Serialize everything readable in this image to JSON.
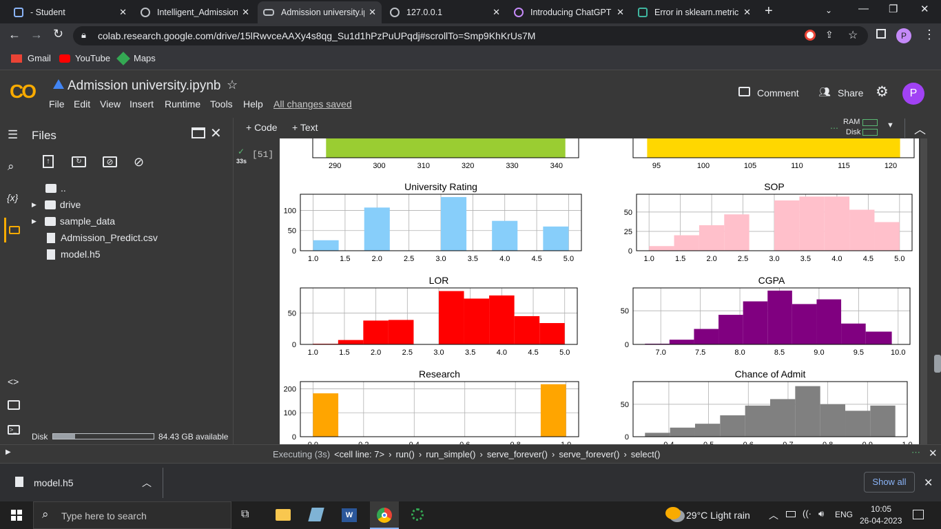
{
  "tabs": [
    {
      "label": "- Student"
    },
    {
      "label": "Intelligent_Admissions"
    },
    {
      "label": "Admission university.ip"
    },
    {
      "label": "127.0.0.1"
    },
    {
      "label": "Introducing ChatGPT"
    },
    {
      "label": "Error in sklearn.metric"
    }
  ],
  "address": {
    "url": "colab.research.google.com/drive/15lRwvceAAXy4s8qg_Su1d1hPzPuUPqdj#scrollTo=Smp9KhKrUs7M"
  },
  "bookmarks": [
    {
      "label": "Gmail"
    },
    {
      "label": "YouTube"
    },
    {
      "label": "Maps"
    }
  ],
  "colab": {
    "logo": "CO",
    "title": "Admission university.ipynb",
    "menu": [
      "File",
      "Edit",
      "View",
      "Insert",
      "Runtime",
      "Tools",
      "Help"
    ],
    "saved": "All changes saved",
    "comment": "Comment",
    "share": "Share",
    "avatar": "P",
    "add_code": "+ Code",
    "add_text": "+ Text",
    "ram": "RAM",
    "disk": "Disk",
    "cell_exec": "[51]",
    "cell_time": "33s"
  },
  "files": {
    "title": "Files",
    "items": [
      "..",
      "drive",
      "sample_data",
      "Admission_Predict.csv",
      "model.h5"
    ],
    "disk_label": "Disk",
    "disk_avail": "84.43 GB available",
    "disk_used_fraction": 0.22
  },
  "status": {
    "executing": "Executing (3s)",
    "trace": [
      "<cell line: 7>",
      "run()",
      "run_simple()",
      "serve_forever()",
      "serve_forever()",
      "select()"
    ]
  },
  "download": {
    "file": "model.h5",
    "show_all": "Show all"
  },
  "taskbar": {
    "search": "Type here to search",
    "weather": "29°C  Light rain",
    "lang": "ENG",
    "time": "10:05",
    "date": "26-04-2023"
  },
  "chart_data": [
    {
      "type": "bar",
      "title": "",
      "partial": true,
      "x_ticks": [
        "290",
        "300",
        "310",
        "320",
        "330",
        "340"
      ],
      "color": "#9acd32"
    },
    {
      "type": "bar",
      "title": "",
      "partial": true,
      "x_ticks": [
        "95",
        "100",
        "105",
        "110",
        "115",
        "120"
      ],
      "color": "#ffd700"
    },
    {
      "type": "bar",
      "title": "University Rating",
      "color": "#87cefa",
      "xlim": [
        0.8,
        5.2
      ],
      "ylim": [
        0,
        140
      ],
      "x_ticks": [
        "1.0",
        "1.5",
        "2.0",
        "2.5",
        "3.0",
        "3.5",
        "4.0",
        "4.5",
        "5.0"
      ],
      "y_ticks": [
        "0",
        "50",
        "100"
      ],
      "bins": [
        [
          1.0,
          1.4,
          26
        ],
        [
          1.8,
          2.2,
          107
        ],
        [
          2.6,
          3.0,
          0
        ],
        [
          3.0,
          3.4,
          133
        ],
        [
          3.8,
          4.2,
          74
        ],
        [
          4.6,
          5.0,
          60
        ]
      ]
    },
    {
      "type": "bar",
      "title": "SOP",
      "color": "#ffc0cb",
      "xlim": [
        0.8,
        5.2
      ],
      "ylim": [
        0,
        73
      ],
      "x_ticks": [
        "1.0",
        "1.5",
        "2.0",
        "2.5",
        "3.0",
        "3.5",
        "4.0",
        "4.5",
        "5.0"
      ],
      "y_ticks": [
        "0",
        "25",
        "50"
      ],
      "bins": [
        [
          1.0,
          1.4,
          6
        ],
        [
          1.4,
          1.8,
          20
        ],
        [
          1.8,
          2.2,
          33
        ],
        [
          2.2,
          2.6,
          47
        ],
        [
          2.6,
          3.0,
          0
        ],
        [
          3.0,
          3.4,
          65
        ],
        [
          3.4,
          3.8,
          70
        ],
        [
          3.8,
          4.2,
          70
        ],
        [
          4.2,
          4.6,
          53
        ],
        [
          4.6,
          5.0,
          37
        ]
      ]
    },
    {
      "type": "bar",
      "title": "LOR",
      "color": "#ff0000",
      "xlim": [
        0.8,
        5.2
      ],
      "ylim": [
        0,
        90
      ],
      "x_ticks": [
        "1.0",
        "1.5",
        "2.0",
        "2.5",
        "3.0",
        "3.5",
        "4.0",
        "4.5",
        "5.0"
      ],
      "y_ticks": [
        "0",
        "50"
      ],
      "bins": [
        [
          1.0,
          1.4,
          1
        ],
        [
          1.4,
          1.8,
          7
        ],
        [
          1.8,
          2.2,
          38
        ],
        [
          2.2,
          2.6,
          39
        ],
        [
          2.6,
          3.0,
          0
        ],
        [
          3.0,
          3.4,
          85
        ],
        [
          3.4,
          3.8,
          73
        ],
        [
          3.8,
          4.2,
          78
        ],
        [
          4.2,
          4.6,
          45
        ],
        [
          4.6,
          5.0,
          34
        ]
      ]
    },
    {
      "type": "bar",
      "title": "CGPA",
      "color": "#800080",
      "xlim": [
        6.65,
        10.15
      ],
      "ylim": [
        0,
        84
      ],
      "x_ticks": [
        "7.0",
        "7.5",
        "8.0",
        "8.5",
        "9.0",
        "9.5",
        "10.0"
      ],
      "y_ticks": [
        "0",
        "50"
      ],
      "bins": [
        [
          6.8,
          7.11,
          1
        ],
        [
          7.11,
          7.42,
          7
        ],
        [
          7.42,
          7.73,
          23
        ],
        [
          7.73,
          8.04,
          44
        ],
        [
          8.04,
          8.35,
          64
        ],
        [
          8.35,
          8.66,
          80
        ],
        [
          8.66,
          8.97,
          60
        ],
        [
          8.97,
          9.28,
          67
        ],
        [
          9.28,
          9.59,
          31
        ],
        [
          9.59,
          9.92,
          19
        ]
      ]
    },
    {
      "type": "bar",
      "title": "Research",
      "color": "#ffa500",
      "xlim": [
        -0.05,
        1.05
      ],
      "ylim": [
        0,
        230
      ],
      "x_ticks": [
        "0.0",
        "0.2",
        "0.4",
        "0.6",
        "0.8",
        "1.0"
      ],
      "y_ticks": [
        "0",
        "100",
        "200"
      ],
      "bins": [
        [
          0.0,
          0.1,
          181
        ],
        [
          0.9,
          1.0,
          219
        ]
      ]
    },
    {
      "type": "bar",
      "title": "Chance of Admit",
      "color": "#808080",
      "xlim": [
        0.31,
        1.0
      ],
      "ylim": [
        0,
        85
      ],
      "x_ticks": [
        "0.4",
        "0.5",
        "0.6",
        "0.7",
        "0.8",
        "0.9",
        "1.0"
      ],
      "y_ticks": [
        "0",
        "50"
      ],
      "bins": [
        [
          0.34,
          0.403,
          6
        ],
        [
          0.403,
          0.466,
          14
        ],
        [
          0.466,
          0.529,
          20
        ],
        [
          0.529,
          0.592,
          33
        ],
        [
          0.592,
          0.655,
          48
        ],
        [
          0.655,
          0.718,
          58
        ],
        [
          0.718,
          0.781,
          78
        ],
        [
          0.781,
          0.844,
          50
        ],
        [
          0.844,
          0.907,
          40
        ],
        [
          0.907,
          0.97,
          48
        ]
      ]
    }
  ]
}
